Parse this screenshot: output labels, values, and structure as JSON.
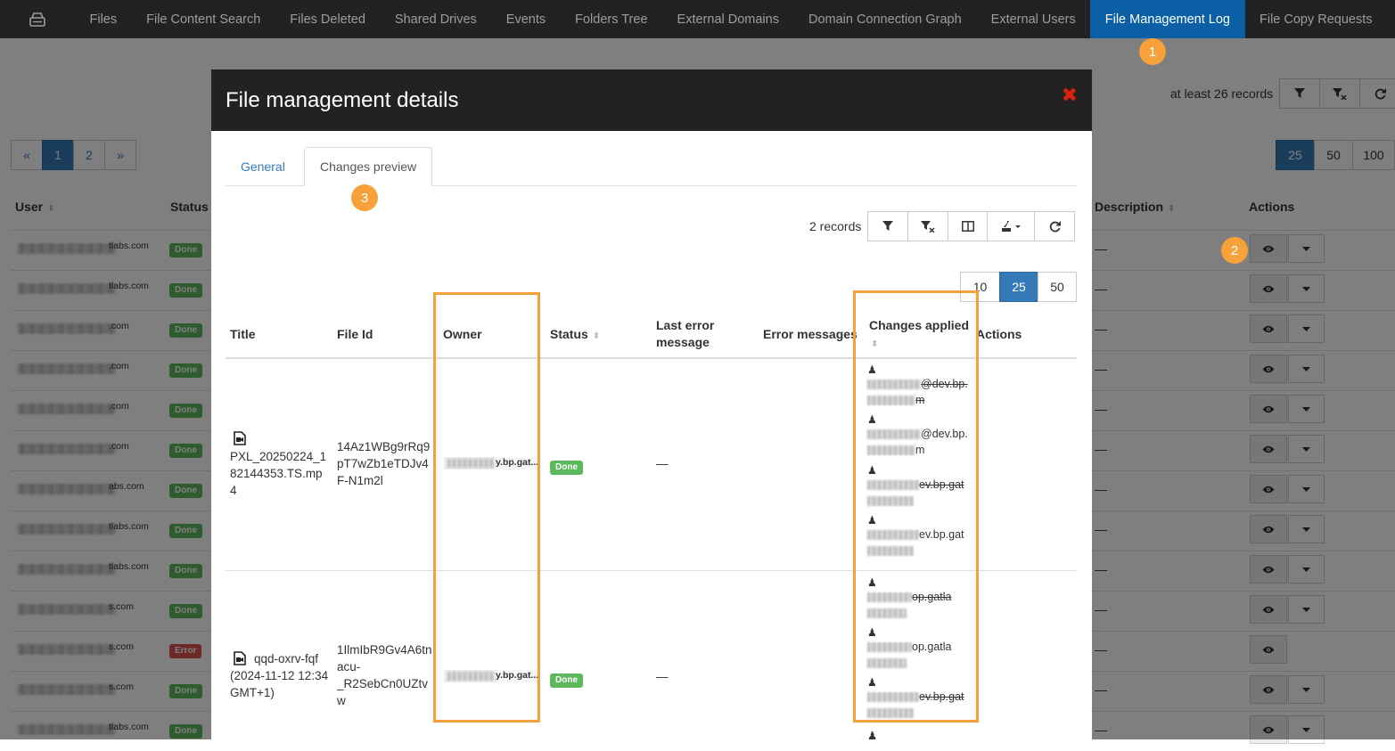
{
  "nav": {
    "items": [
      "Files",
      "File Content Search",
      "Files Deleted",
      "Shared Drives",
      "Events",
      "Folders Tree",
      "External Domains",
      "Domain Connection Graph",
      "External Users",
      "File Management Log",
      "File Copy Requests"
    ],
    "active": "File Management Log"
  },
  "background": {
    "records_text": "at least 26 records",
    "pager": [
      "«",
      "1",
      "2",
      "»"
    ],
    "page_sizes": [
      "25",
      "50",
      "100"
    ],
    "columns": {
      "user": "User",
      "status": "Status",
      "description": "Description",
      "actions": "Actions"
    },
    "rows": [
      {
        "email_suffix": "tlabs.com",
        "status": "Done",
        "description": "—",
        "has_caret": true
      },
      {
        "email_suffix": "tlabs.com",
        "status": "Done",
        "description": "—",
        "has_caret": true
      },
      {
        "email_suffix": ".com",
        "status": "Done",
        "description": "—",
        "has_caret": true
      },
      {
        "email_suffix": ".com",
        "status": "Done",
        "description": "—",
        "has_caret": true
      },
      {
        "email_suffix": ".com",
        "status": "Done",
        "description": "—",
        "has_caret": true
      },
      {
        "email_suffix": ".com",
        "status": "Done",
        "description": "—",
        "has_caret": true
      },
      {
        "email_suffix": "abs.com",
        "status": "Done",
        "description": "—",
        "has_caret": true
      },
      {
        "email_suffix": "tlabs.com",
        "status": "Done",
        "description": "—",
        "has_caret": true
      },
      {
        "email_suffix": "tlabs.com",
        "status": "Done",
        "description": "—",
        "has_caret": true
      },
      {
        "email_suffix": "s.com",
        "status": "Done",
        "description": "—",
        "has_caret": true
      },
      {
        "email_suffix": "s.com",
        "status": "Error",
        "description": "—",
        "has_caret": false
      },
      {
        "email_suffix": "s.com",
        "status": "Done",
        "description": "—",
        "has_caret": true
      },
      {
        "email_suffix": "tlabs.com",
        "status": "Done",
        "description": "—",
        "has_caret": true
      }
    ]
  },
  "modal": {
    "title": "File management details",
    "tabs": {
      "general": "General",
      "changes_preview": "Changes preview"
    },
    "records_text": "2 records",
    "page_sizes": [
      "10",
      "25",
      "50"
    ],
    "columns": {
      "title": "Title",
      "file_id": "File Id",
      "owner": "Owner",
      "status": "Status",
      "last_error_1": "Last error",
      "last_error_2": "message",
      "error_messages": "Error messages",
      "changes_applied": "Changes applied",
      "actions": "Actions"
    },
    "rows": [
      {
        "title_lines": [
          "PXL_20250224_1",
          "82144353.TS.mp",
          "4"
        ],
        "file_id_lines": [
          "14Az1WBg9rRq9",
          "pT7wZb1eTDJv4",
          "F-N1m2l"
        ],
        "owner_suffix": "y.bp.gat...",
        "status": "Done",
        "last_error": "—"
      },
      {
        "title_lines": [
          "qqd-oxrv-fqf",
          "(2024-11-12 12:34",
          "GMT+1)"
        ],
        "file_id_lines": [
          "1IlmIbR9Gv4A6tn",
          "acu-",
          "_R2SebCn0UZtv",
          "w"
        ],
        "owner_suffix": "y.bp.gat...",
        "status": "Done",
        "last_error": "—"
      }
    ],
    "changes": [
      {
        "line1": "@dev.bp.",
        "line2": "m",
        "strike": true
      },
      {
        "line1": "@dev.bp.",
        "line2": "m",
        "strike": false
      },
      {
        "line1": "ev.bp.gat",
        "line2": "",
        "strike": true
      },
      {
        "line1": "ev.bp.gat",
        "line2": "",
        "strike": false
      },
      {
        "line1": "op.gatla",
        "line2": "",
        "strike": true
      },
      {
        "line1": "op.gatla",
        "line2": "",
        "strike": false
      },
      {
        "line1": "ev.bp.gat",
        "line2": "",
        "strike": true
      }
    ]
  },
  "markers": [
    "1",
    "2",
    "3"
  ],
  "colors": {
    "accent": "#f5a03a",
    "primary": "#337ab7",
    "done": "#5cb85c",
    "error": "#d9534f",
    "close": "#d9230f"
  },
  "icons": [
    "home-icon",
    "filter-icon",
    "clear-filter-icon",
    "refresh-icon",
    "columns-icon",
    "export-icon",
    "eye-icon",
    "caret-down-icon",
    "video-file-icon",
    "person-icon",
    "close-icon"
  ]
}
